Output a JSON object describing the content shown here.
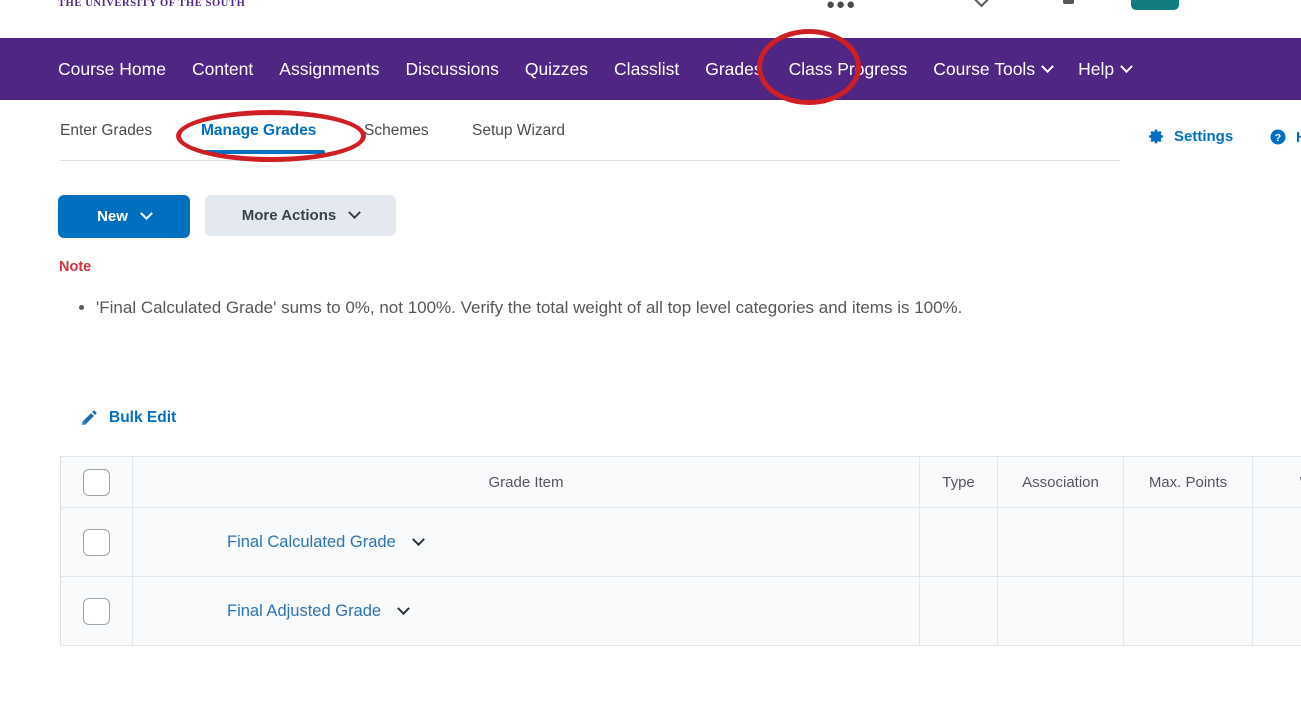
{
  "brand": {
    "name": "THE UNIVERSITY OF THE SOUTH"
  },
  "topbar": {
    "waffle_icon": "grid-dots-icon",
    "chevron_icon": "chevron-down-icon",
    "notifications_icon": "bell-icon",
    "profile_pill_color": "#127d81"
  },
  "navbar": {
    "background": "#4f2683",
    "items": [
      {
        "label": "Course Home",
        "has_chevron": false
      },
      {
        "label": "Content",
        "has_chevron": false
      },
      {
        "label": "Assignments",
        "has_chevron": false
      },
      {
        "label": "Discussions",
        "has_chevron": false
      },
      {
        "label": "Quizzes",
        "has_chevron": false
      },
      {
        "label": "Classlist",
        "has_chevron": false
      },
      {
        "label": "Grades",
        "has_chevron": false
      },
      {
        "label": "Class Progress",
        "has_chevron": false
      },
      {
        "label": "Course Tools",
        "has_chevron": true
      },
      {
        "label": "Help",
        "has_chevron": true
      }
    ]
  },
  "tabs": {
    "items": [
      {
        "label": "Enter Grades",
        "active": false
      },
      {
        "label": "Manage Grades",
        "active": true
      },
      {
        "label": "Schemes",
        "active": false
      },
      {
        "label": "Setup Wizard",
        "active": false
      }
    ],
    "active_color": "#006fbf"
  },
  "utilities": {
    "settings_label": "Settings",
    "settings_icon": "gear-icon",
    "help_label": "H",
    "help_icon": "question-circle-icon"
  },
  "actions": {
    "new_label": "New",
    "more_actions_label": "More Actions",
    "new_color": "#006fbf",
    "more_actions_color": "#e3e9ef"
  },
  "note": {
    "heading": "Note",
    "heading_color": "#d1323c",
    "messages": [
      "'Final Calculated Grade' sums to 0%, not 100%. Verify the total weight of all top level categories and items is 100%."
    ]
  },
  "bulk_edit": {
    "label": "Bulk Edit",
    "icon": "pencil-edit-icon"
  },
  "table": {
    "select_all_icon": "checkbox-unchecked",
    "columns": [
      {
        "key": "check",
        "label": ""
      },
      {
        "key": "item",
        "label": "Grade Item"
      },
      {
        "key": "type",
        "label": "Type"
      },
      {
        "key": "association",
        "label": "Association"
      },
      {
        "key": "max_points",
        "label": "Max. Points"
      },
      {
        "key": "weight",
        "label": "Wei"
      }
    ],
    "rows": [
      {
        "name": "Final Calculated Grade",
        "type": "",
        "association": "",
        "max_points": "",
        "weight": "",
        "chevron_icon": "chevron-down-icon"
      },
      {
        "name": "Final Adjusted Grade",
        "type": "",
        "association": "",
        "max_points": "",
        "weight": "",
        "chevron_icon": "chevron-down-icon"
      }
    ]
  },
  "annotations": {
    "color": "#cf1f25",
    "shapes": [
      {
        "target": "Grades",
        "type": "ellipse"
      },
      {
        "target": "Manage Grades",
        "type": "ellipse"
      }
    ]
  }
}
